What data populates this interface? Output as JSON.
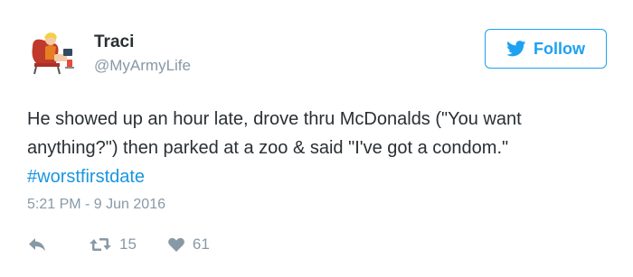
{
  "tweet": {
    "author_name": "Traci",
    "author_handle": "@MyArmyLife",
    "text_before_hashtag": "He showed up an hour late, drove thru McDonalds (\"You want anything?\") then parked at a zoo & said \"I've got a condom.\" ",
    "hashtag": "#worstfirstdate",
    "timestamp": "5:21 PM - 9 Jun 2016",
    "retweet_count": "15",
    "like_count": "61"
  },
  "follow_button": {
    "label": "Follow",
    "icon": "twitter-bird-icon"
  },
  "icons": {
    "reply": "reply-icon",
    "retweet": "retweet-icon",
    "like": "heart-icon",
    "avatar": "avatar-illustration"
  },
  "colors": {
    "accent": "#1da1f2",
    "hashtag": "#1b95e0",
    "text": "#292f33",
    "muted": "#8899a6"
  }
}
